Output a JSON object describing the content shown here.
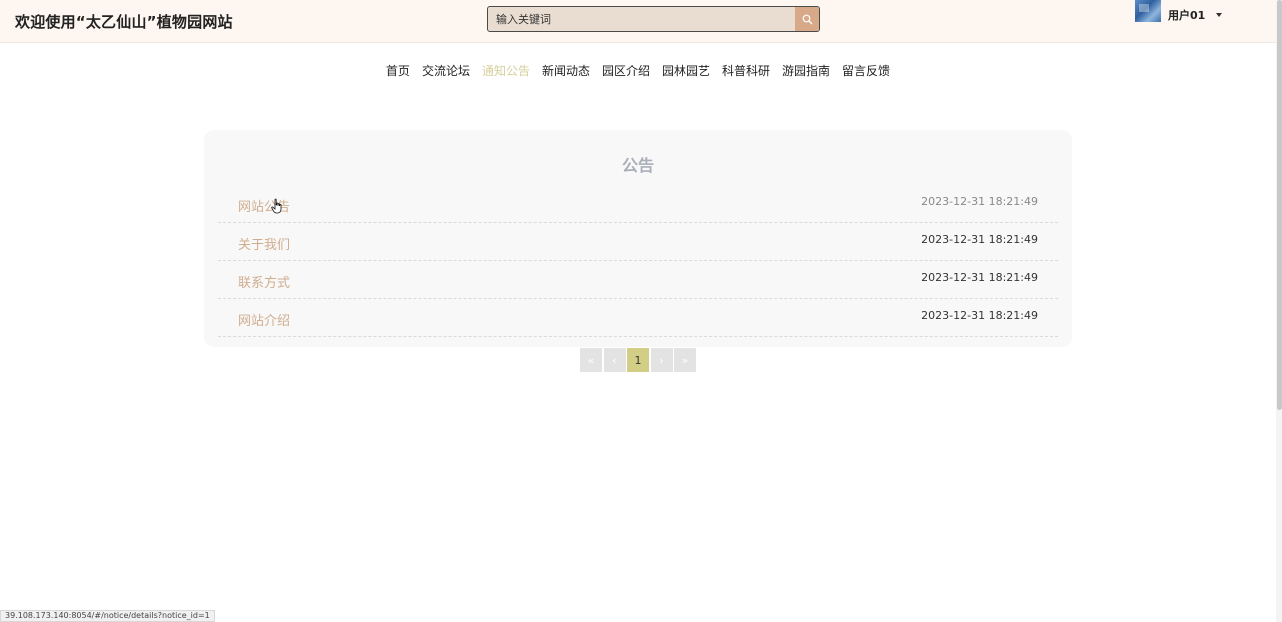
{
  "header": {
    "site_title": "欢迎使用“太乙仙山”植物园网站",
    "search_placeholder": "输入关键词",
    "user_name": "用户01"
  },
  "nav": {
    "items": [
      "首页",
      "交流论坛",
      "通知公告",
      "新闻动态",
      "园区介绍",
      "园林园艺",
      "科普科研",
      "游园指南",
      "留言反馈"
    ],
    "active": "通知公告"
  },
  "panel": {
    "title": "公告",
    "notices": [
      {
        "title": "网站公告",
        "time": "2023-12-31 18:21:49"
      },
      {
        "title": "关于我们",
        "time": "2023-12-31 18:21:49"
      },
      {
        "title": "联系方式",
        "time": "2023-12-31 18:21:49"
      },
      {
        "title": "网站介绍",
        "time": "2023-12-31 18:21:49"
      }
    ]
  },
  "pager": {
    "first": "«",
    "prev": "‹",
    "current": "1",
    "next": "›",
    "last": "»"
  },
  "status_bar": {
    "url": "39.108.173.140:8054/#/notice/details?notice_id=1"
  },
  "colors": {
    "accent": "#d8a988",
    "active_nav": "#d6cf9a",
    "notice_title": "#d0ad8f",
    "current_page": "#d3ce86"
  },
  "icons": {
    "search": "search-icon",
    "caret": "caret-down-icon",
    "cursor": "hand-pointer-icon"
  }
}
